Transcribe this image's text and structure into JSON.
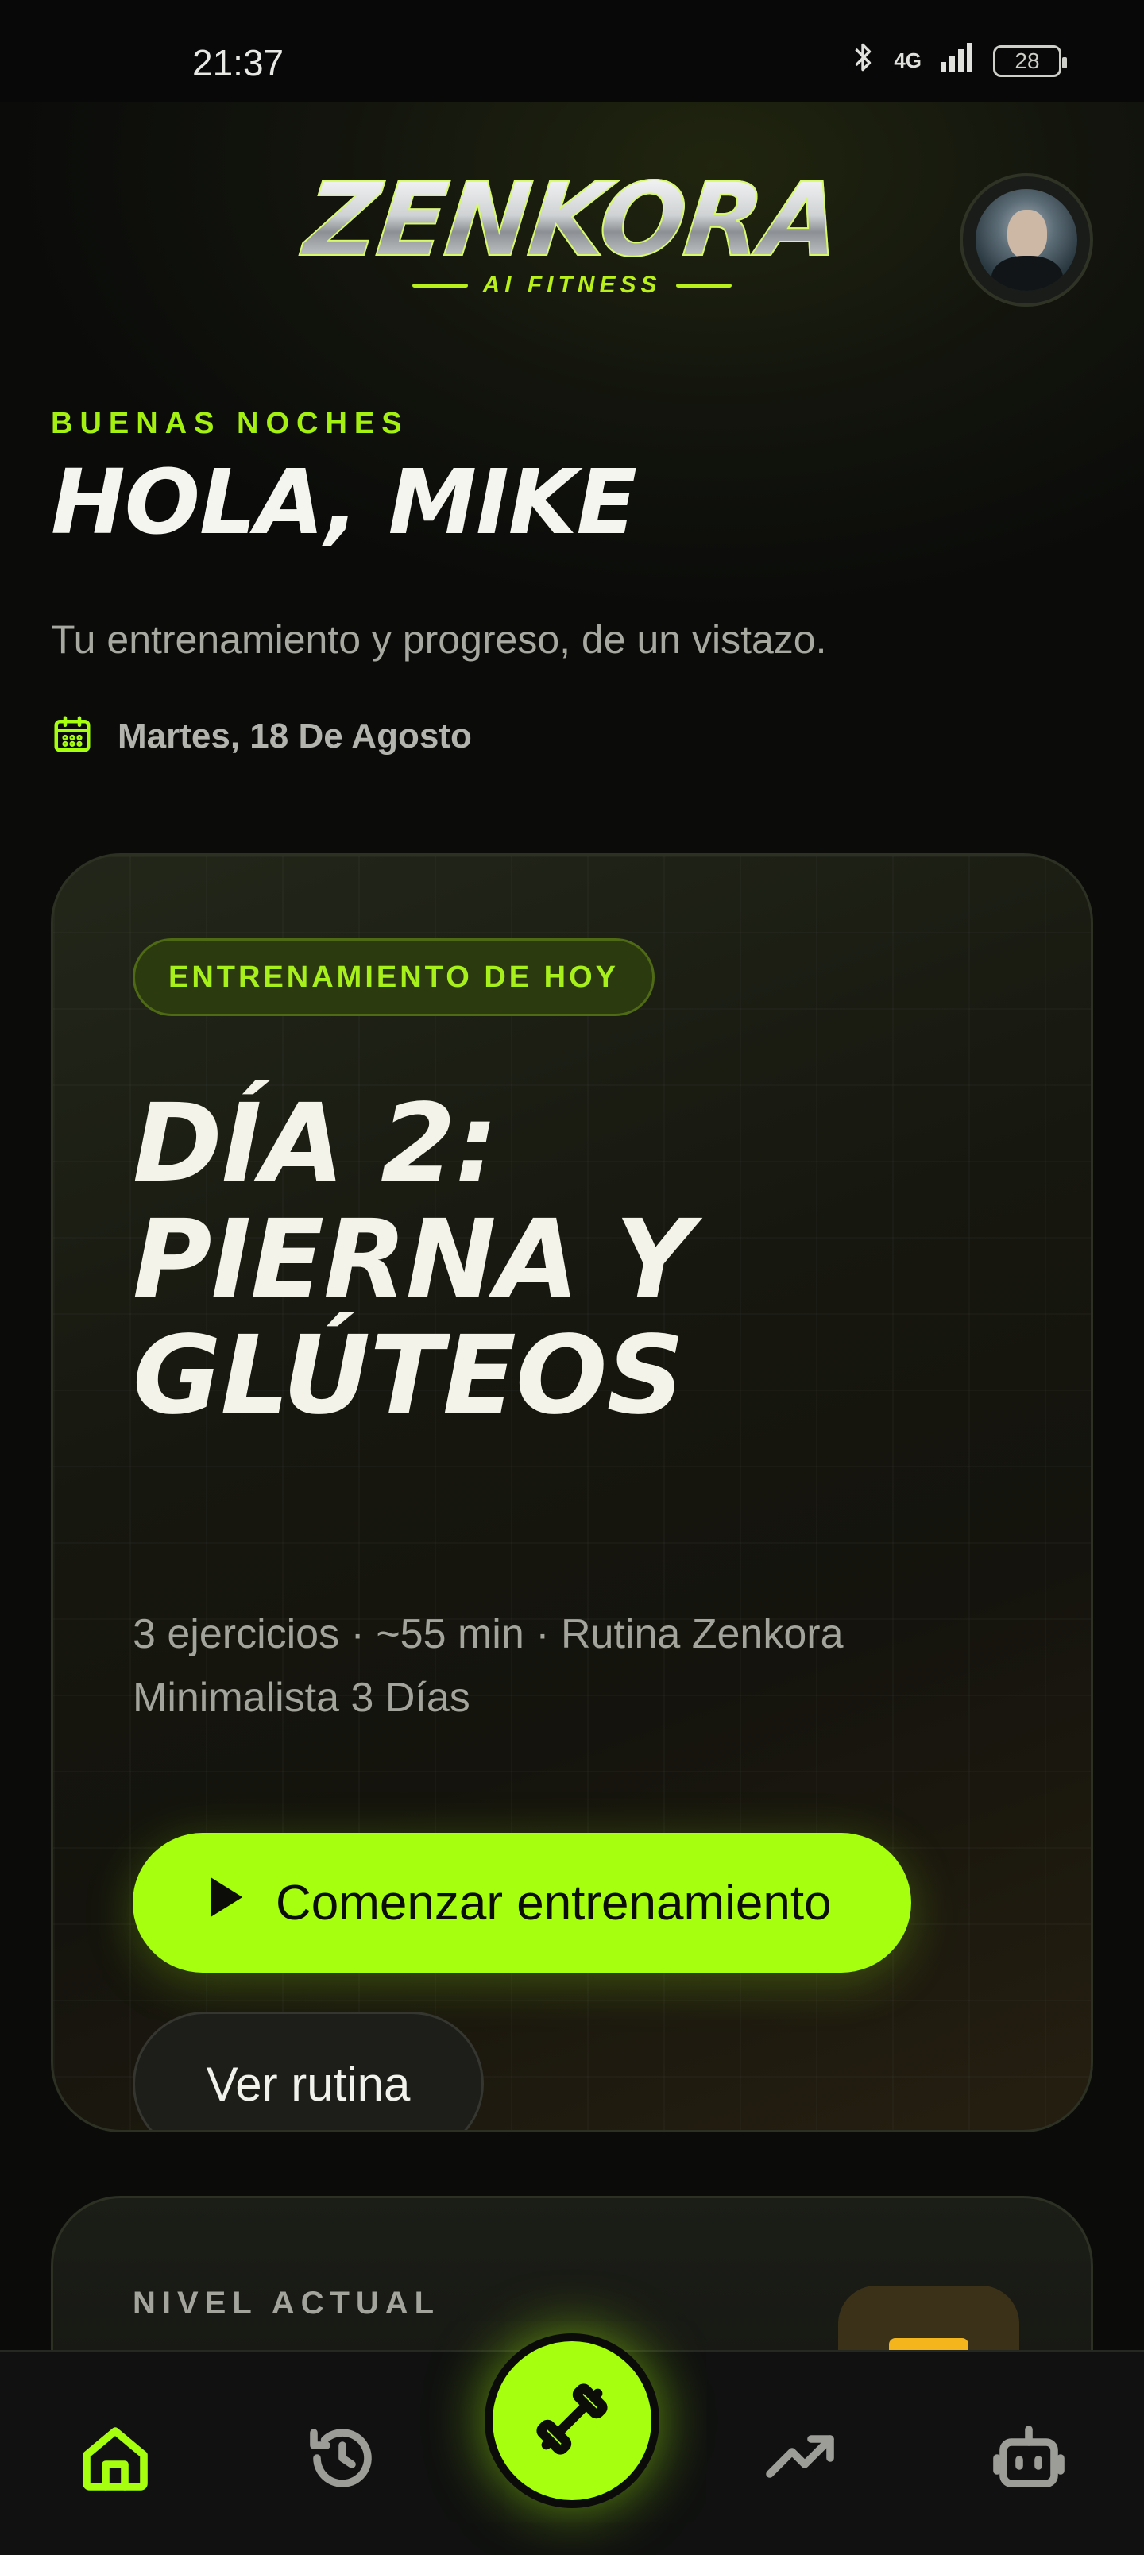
{
  "status_bar": {
    "time": "21:37",
    "network": "4G",
    "battery": "28"
  },
  "header": {
    "logo_text": "ZENKORA",
    "logo_subtext": "AI FITNESS"
  },
  "greeting": {
    "eyebrow": "BUENAS NOCHES",
    "title": "HOLA, MIKE",
    "subtitle": "Tu entrenamiento y progreso, de un vistazo.",
    "date": "Martes, 18 De Agosto"
  },
  "today_card": {
    "badge": "ENTRENAMIENTO DE HOY",
    "title_line1": "DÍA 2:",
    "title_line2": "PIERNA Y",
    "title_line3": "GLÚTEOS",
    "meta_line1": "3 ejercicios · ~55 min · Rutina Zenkora",
    "meta_line2": "Minimalista 3 Días",
    "start_button": "Comenzar entrenamiento",
    "view_button": "Ver rutina"
  },
  "level_card": {
    "label": "NIVEL ACTUAL"
  },
  "bottom_nav": {
    "items": [
      "home-icon",
      "history-icon",
      "workout-dumbbell-icon",
      "trending-up-icon",
      "robot-icon"
    ],
    "active": "home-icon"
  },
  "colors": {
    "accent": "#a6ff0e",
    "background": "#0b0c0a",
    "badge_bg": "#2b3a0f",
    "level_icon": "#f3b51b"
  }
}
